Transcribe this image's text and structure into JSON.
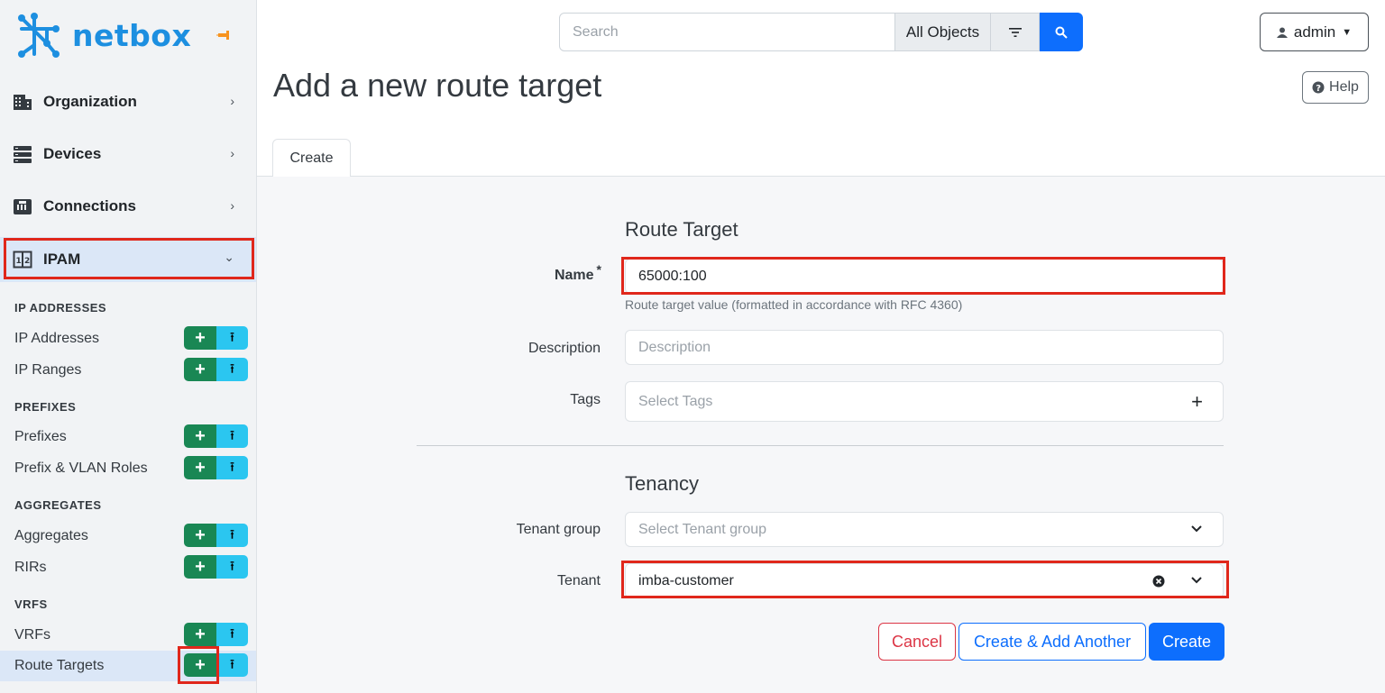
{
  "brand": {
    "name": "netbox"
  },
  "sidebar": {
    "nav": [
      {
        "label": "Organization",
        "icon": "building-icon"
      },
      {
        "label": "Devices",
        "icon": "server-icon"
      },
      {
        "label": "Connections",
        "icon": "ethernet-icon"
      },
      {
        "label": "IPAM",
        "icon": "counter-icon"
      }
    ],
    "sections": [
      {
        "title": "IP ADDRESSES",
        "items": [
          "IP Addresses",
          "IP Ranges"
        ]
      },
      {
        "title": "PREFIXES",
        "items": [
          "Prefixes",
          "Prefix & VLAN Roles"
        ]
      },
      {
        "title": "AGGREGATES",
        "items": [
          "Aggregates",
          "RIRs"
        ]
      },
      {
        "title": "VRFS",
        "items": [
          "VRFs",
          "Route Targets"
        ]
      }
    ],
    "add_symbol": "+",
    "import_symbol": "⭱"
  },
  "topbar": {
    "search_placeholder": "Search",
    "scope": "All Objects",
    "user": "admin"
  },
  "page": {
    "title": "Add a new route target",
    "help": "Help",
    "tab": "Create"
  },
  "form": {
    "route_target_title": "Route Target",
    "name_label": "Name",
    "name_required": "*",
    "name_value": "65000:100",
    "name_help": "Route target value (formatted in accordance with RFC 4360)",
    "description_label": "Description",
    "description_placeholder": "Description",
    "tags_label": "Tags",
    "tags_placeholder": "Select Tags",
    "tenancy_title": "Tenancy",
    "tenant_group_label": "Tenant group",
    "tenant_group_placeholder": "Select Tenant group",
    "tenant_label": "Tenant",
    "tenant_value": "imba-customer"
  },
  "actions": {
    "cancel": "Cancel",
    "create_add_another": "Create & Add Another",
    "create": "Create"
  },
  "colors": {
    "brand": "#1d8fe0",
    "primary": "#0d6efd",
    "success": "#198754",
    "info": "#2bc6f0",
    "danger": "#dc3545",
    "highlight": "#e0271b"
  }
}
